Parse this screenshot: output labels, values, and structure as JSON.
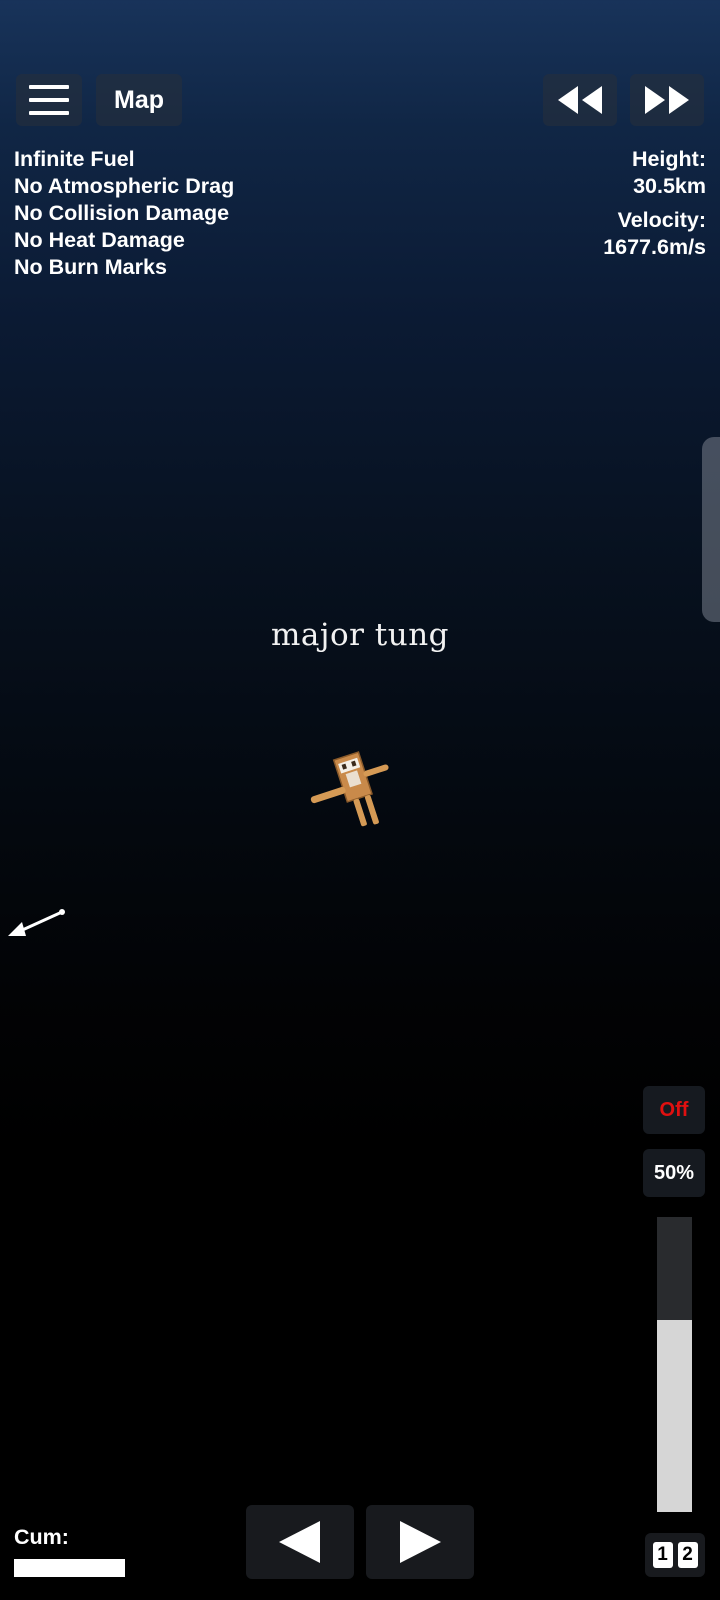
{
  "toolbar": {
    "menu_icon": "hamburger-icon",
    "map_label": "Map",
    "rewind_icon": "rewind-icon",
    "fast_forward_icon": "fast-forward-icon"
  },
  "cheats": [
    "Infinite Fuel",
    "No Atmospheric Drag",
    "No Collision Damage",
    "No Heat Damage",
    "No Burn Marks"
  ],
  "telemetry": {
    "height_label": "Height:",
    "height_value": "30.5km",
    "velocity_label": "Velocity:",
    "velocity_value": "1677.6m/s"
  },
  "craft": {
    "name": "major tung"
  },
  "controls": {
    "toggle_label": "Off",
    "toggle_color": "#e01010",
    "throttle_label": "50%",
    "throttle_level": 0.65,
    "cum_label": "Cum:",
    "cum_level": 1.0,
    "prev_icon": "left-triangle-icon",
    "next_icon": "right-triangle-icon",
    "page_numbers": [
      "1",
      "2"
    ]
  }
}
